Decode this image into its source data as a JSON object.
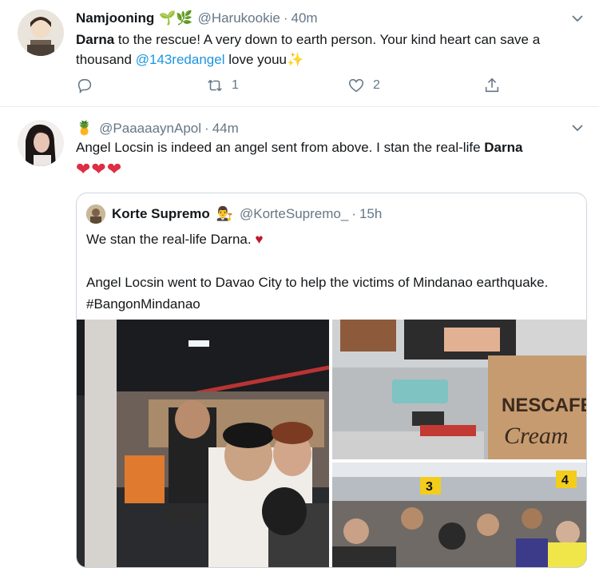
{
  "tweets": [
    {
      "name": "Namjooning",
      "emoji": "🌱🌿",
      "handle": "@Harukookie",
      "separator": "·",
      "time": "40m",
      "text_bold": "Darna",
      "text_part1": " to the rescue! A very down to earth person. Your kind heart can save a thousand ",
      "mention": "@143redangel",
      "text_part2": " love youu",
      "sparkle": "✨",
      "reply_count": "",
      "retweet_count": "1",
      "like_count": "2"
    },
    {
      "emoji": "🍍",
      "handle": "@PaaaaaynApol",
      "separator": "·",
      "time": "44m",
      "text_part1": "Angel Locsin is indeed an angel sent from above. I stan the real-life ",
      "text_bold": "Darna",
      "hearts": "❤❤❤",
      "quote": {
        "name": "Korte Supremo",
        "emoji": "👨‍⚖️",
        "handle": "@KorteSupremo_",
        "separator": "·",
        "time": "15h",
        "line1": "We stan the real-life Darna. ",
        "line1_heart": "♥",
        "line2": "Angel Locsin went to Davao City to help the victims of Mindanao earthquake.  #BangonMindanao"
      }
    }
  ],
  "photos": {
    "box_text_1": "NESCAFE",
    "box_text_2": "Cream",
    "sign_3": "3",
    "sign_4": "4"
  },
  "colors": {
    "link": "#1b95e0",
    "muted": "#657786",
    "heart": "#dd2e44",
    "border": "#e6ecf0"
  },
  "icons": [
    "chevron-down-icon",
    "reply-icon",
    "retweet-icon",
    "like-icon",
    "share-icon"
  ]
}
